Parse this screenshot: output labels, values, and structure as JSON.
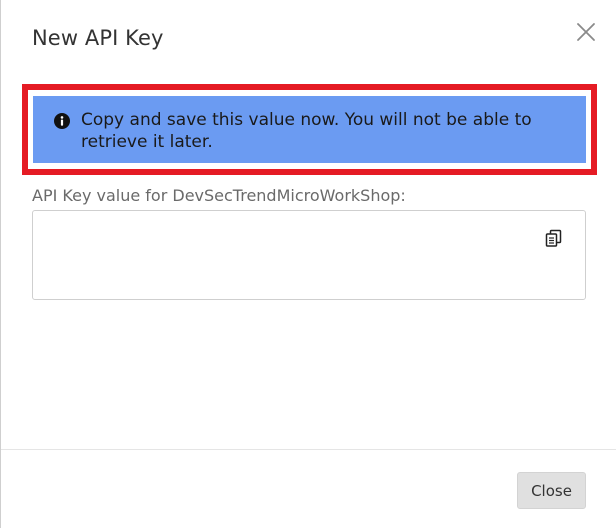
{
  "dialog": {
    "title": "New API Key",
    "close_icon": "close-icon"
  },
  "callout": {
    "icon": "info-icon",
    "message": "Copy and save this value now. You will not be able to retrieve it later.",
    "highlight_color": "#e51b24",
    "background_color": "#6b9bf2"
  },
  "api_key": {
    "label": "API Key value for DevSecTrendMicroWorkShop:",
    "value": "",
    "copy_icon": "copy-icon"
  },
  "footer": {
    "close_label": "Close"
  }
}
